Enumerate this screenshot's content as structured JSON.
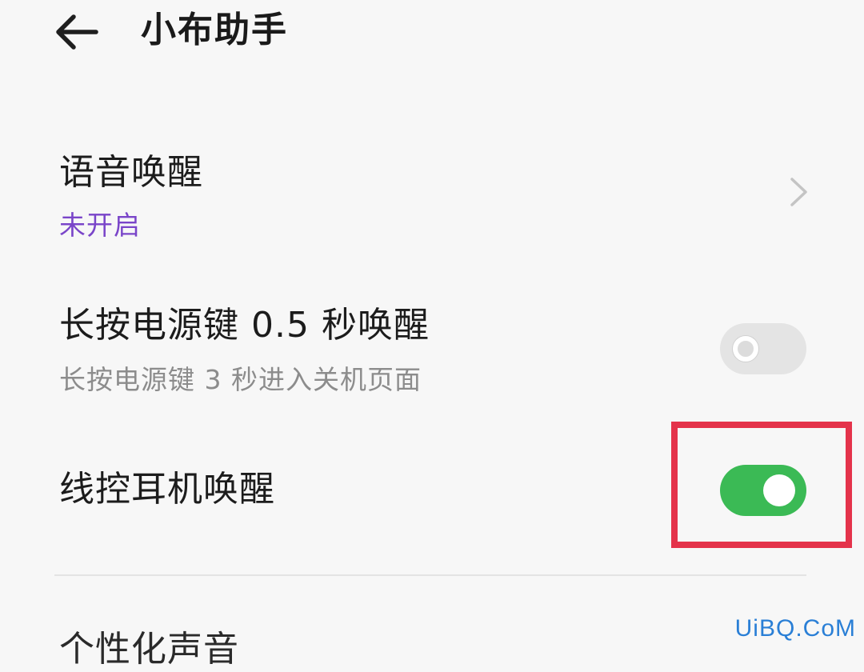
{
  "header": {
    "title": "小布助手",
    "back_icon": "arrow-left-icon"
  },
  "settings": {
    "voice_wake": {
      "title": "语音唤醒",
      "status": "未开启",
      "status_color": "#7a45c9",
      "icon": "chevron-right-icon"
    },
    "power_key_wake": {
      "title": "长按电源键 0.5 秒唤醒",
      "subtitle": "长按电源键 3 秒进入关机页面",
      "enabled": false
    },
    "headset_wake": {
      "title": "线控耳机唤醒",
      "enabled": true,
      "switch_color": "#3bba55",
      "highlight_color": "#e4334b"
    },
    "personalized_voice": {
      "title": "个性化声音"
    }
  },
  "watermark": {
    "text": "UiBQ.CoM",
    "color": "#2a7fd6"
  }
}
